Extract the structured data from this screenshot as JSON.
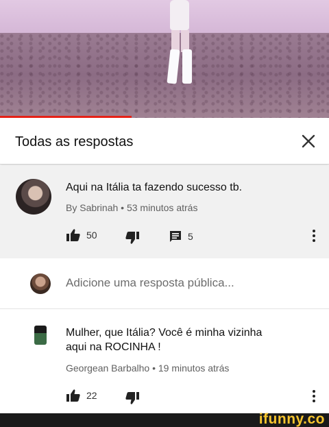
{
  "panel": {
    "title": "Todas as respostas"
  },
  "comment": {
    "text": "Aqui na Itália ta fazendo sucesso tb.",
    "meta": "By Sabrinah • 53 minutos atrás",
    "likes": "50",
    "replies": "5"
  },
  "reply_input": {
    "placeholder": "Adicione uma resposta pública..."
  },
  "reply": {
    "text_line1": "Mulher, que Itália? Você é minha vizinha",
    "text_line2": "aqui na ROCINHA !",
    "meta": "Georgean Barbalho • 19 minutos atrás",
    "likes": "22"
  },
  "watermark": {
    "logo": "ifunny.co"
  },
  "icons": {
    "close": "close-icon",
    "like": "thumbs-up-icon",
    "dislike": "thumbs-down-icon",
    "reply": "comment-icon",
    "more": "more-vert-icon"
  },
  "colors": {
    "progress": "#e62117",
    "logo": "#f7c52e",
    "comment_bg": "#f1f1f1"
  }
}
